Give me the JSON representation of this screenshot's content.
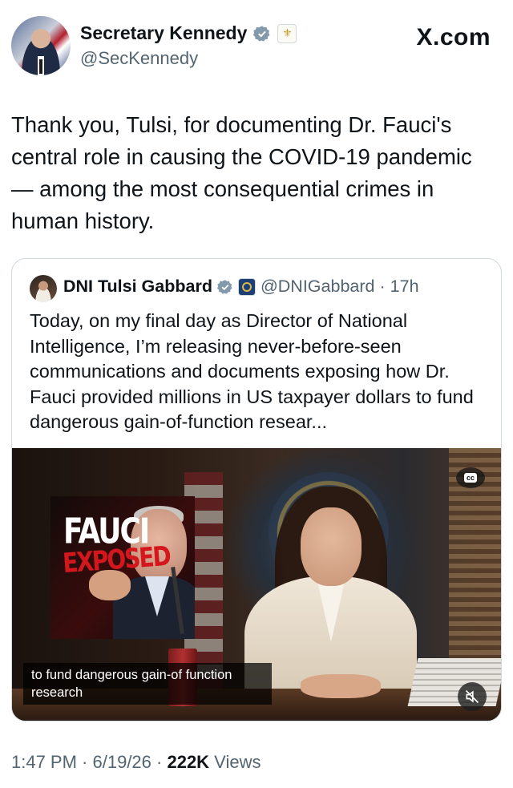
{
  "header": {
    "display_name": "Secretary Kennedy",
    "handle": "@SecKennedy",
    "brand": "X.com"
  },
  "tweet": {
    "text": "Thank you, Tulsi, for documenting Dr. Fauci's central role in causing the COVID-19 pandemic — among the most consequential crimes in human history."
  },
  "quote": {
    "display_name": "DNI Tulsi Gabbard",
    "handle": "@DNIGabbard",
    "separator": "·",
    "time": "17h",
    "text": "Today, on my final day as Director of National Intelligence, I’m releasing never-before-seen communications and documents exposing how Dr. Fauci provided millions in US taxpayer dollars to fund dangerous gain-of-function resear...",
    "video": {
      "thumbnail_title": "FAUCI",
      "thumbnail_subtitle": "EXPOSED",
      "caption": "to fund dangerous gain-of function research",
      "cc_label": "cc"
    }
  },
  "footer": {
    "time": "1:47 PM",
    "sep1": " · ",
    "date": "6/19/26",
    "sep2": " · ",
    "views_count": "222K",
    "views_label": " Views"
  },
  "colors": {
    "text": "#0f1419",
    "secondary": "#536471",
    "verified": "#829aab",
    "border": "#cfd9de"
  }
}
